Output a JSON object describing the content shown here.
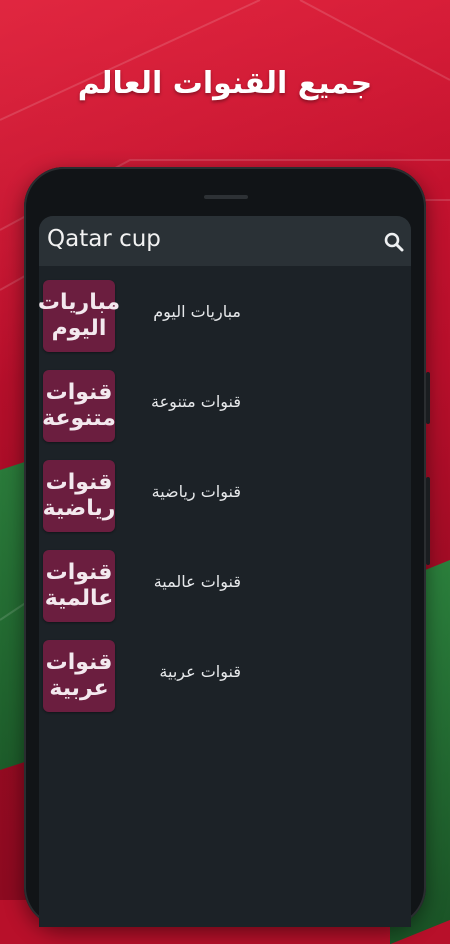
{
  "headline": "جميع القنوات العالم",
  "app": {
    "title": "Qatar cup",
    "search_icon": "search-icon"
  },
  "channels": [
    {
      "thumb_line1": "مباريات",
      "thumb_line2": "اليوم",
      "label": "مباريات اليوم"
    },
    {
      "thumb_line1": "قنوات",
      "thumb_line2": "متنوعة",
      "label": "قنوات متنوعة"
    },
    {
      "thumb_line1": "قنوات",
      "thumb_line2": "رياضية",
      "label": "قنوات رياضية"
    },
    {
      "thumb_line1": "قنوات",
      "thumb_line2": "عالمية",
      "label": "قنوات عالمية"
    },
    {
      "thumb_line1": "قنوات",
      "thumb_line2": "عربية",
      "label": "قنوات عربية"
    }
  ],
  "colors": {
    "background": "#b8102a",
    "screen": "#1c2227",
    "appbar": "#2a3136",
    "thumb": "#6b1e3f"
  }
}
